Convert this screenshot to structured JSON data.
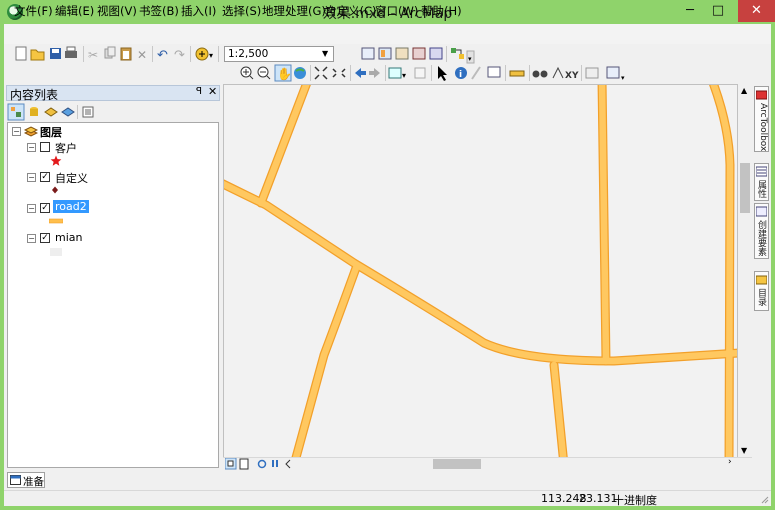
{
  "window": {
    "title": "效果.mxd - ArcMap",
    "minimize": "─",
    "maximize": "□",
    "close": "✕"
  },
  "menu": [
    "文件(F)",
    "编辑(E)",
    "视图(V)",
    "书签(B)",
    "插入(I)",
    "选择(S)",
    "地理处理(G)",
    "自定义(C)",
    "窗口(W)",
    "帮助(H)"
  ],
  "toolbar": {
    "scale": "1:2,500"
  },
  "toc": {
    "title": "内容列表",
    "pin": "ꟼ",
    "close": "✕",
    "root": "图层",
    "layers": [
      {
        "name": "客户",
        "checked": false,
        "symbol": "star",
        "symbol_color": "#e31a1c"
      },
      {
        "name": "自定义",
        "checked": true,
        "symbol": "dot",
        "symbol_color": "#7a1a1a"
      },
      {
        "name": "road2",
        "checked": true,
        "symbol": "line",
        "symbol_color": "#ffbf4d",
        "selected": true
      },
      {
        "name": "mian",
        "checked": true,
        "symbol": "fill",
        "symbol_color": "#eeeeee"
      }
    ]
  },
  "right_dock": {
    "tabs": [
      "ArcToolbox",
      "属性",
      "创建要素",
      "目录"
    ]
  },
  "map": {
    "road_color": "#ffbf4d",
    "road_edge": "#f2a02a",
    "background": "#f2f2f2"
  },
  "bottom": {
    "tab_label": "准备"
  },
  "status": {
    "x": "113.248",
    "y": "23.131",
    "units": "十进制度"
  }
}
